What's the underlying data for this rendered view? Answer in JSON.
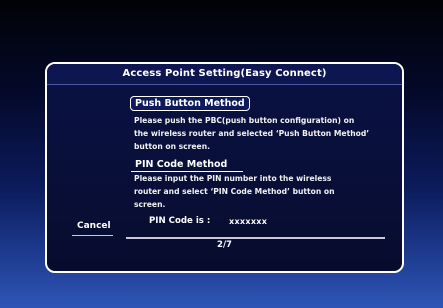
{
  "dialog": {
    "title": "Access Point Setting(Easy Connect)",
    "push_button": {
      "label": "Push Button Method",
      "description_lines": [
        "Please push the PBC(push button configuration) on",
        "the wireless router and selected ‘Push Button Method’",
        "button on screen."
      ]
    },
    "pin_code": {
      "label": "PIN Code Method",
      "description_lines": [
        "Please input the PIN number into the wireless",
        "router and select ‘PIN Code Method’ button on",
        "screen."
      ],
      "pin_label": "PIN Code is :",
      "pin_value": "xxxxxxx"
    },
    "cancel_label": "Cancel",
    "page_indicator": "2/7"
  }
}
